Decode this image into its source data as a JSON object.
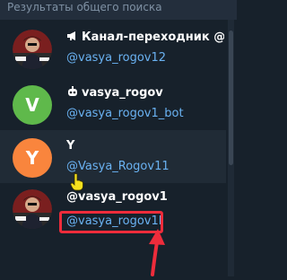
{
  "section_header": "Результаты общего поиска",
  "results": [
    {
      "name": "Канал-переходник @vasya_rogov",
      "username": "@vasya_rogov12",
      "prefix_icon": "channel-megaphone-icon",
      "avatar": "photo"
    },
    {
      "name": "vasya_rogov",
      "username": "@vasya_rogov1_bot",
      "prefix_icon": "bot-icon",
      "avatar": "letter",
      "letter": "V",
      "avatar_color": "#5fb94b"
    },
    {
      "name": "Y",
      "username": "@Vasya_Rogov11",
      "avatar": "letter",
      "letter": "Y",
      "avatar_color": "#f9853d"
    },
    {
      "name": "@vasya_rogov1",
      "username": "@vasya_rogov1l",
      "avatar": "photo"
    }
  ],
  "colors": {
    "background": "#17212b",
    "header_bg": "#232e3c",
    "username_link": "#6ab2f2",
    "annotation_red": "#ee2c3b"
  },
  "annotations": {
    "highlight_box_target": "result-4-username",
    "cursor_icon": "hand-pointer-icon",
    "arrow_icon": "red-arrow-icon"
  }
}
